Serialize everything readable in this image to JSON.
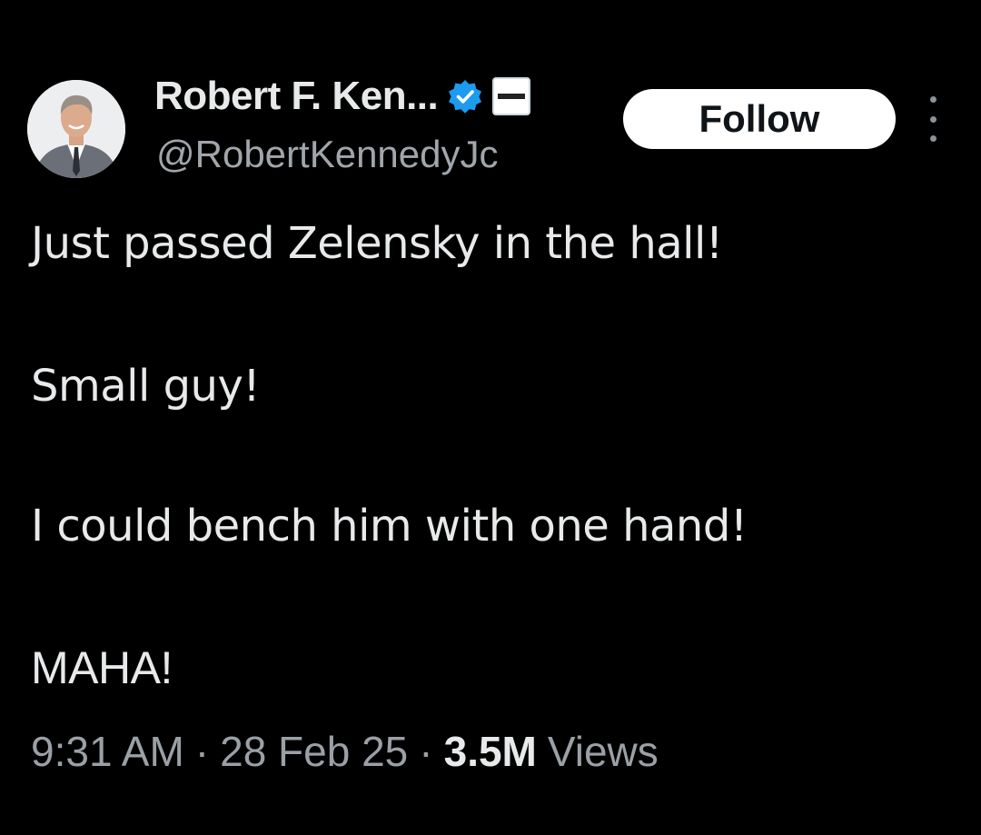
{
  "author": {
    "display_name": "Robert F. Ken...",
    "handle": "@RobertKennedyJc",
    "verified": true,
    "verified_color": "#1d9bf0"
  },
  "follow_button": {
    "label": "Follow"
  },
  "tweet": {
    "lines": [
      "Just passed Zelensky in the hall!",
      "Small guy!",
      "I could bench him with one hand!",
      "MAHA!"
    ]
  },
  "meta": {
    "time": "9:31 AM",
    "separator": "·",
    "date": "28 Feb 25",
    "views_count": "3.5M",
    "views_label": "Views"
  },
  "colors": {
    "background": "#000000",
    "text_primary": "#e7e9ea",
    "text_secondary": "#9aa0a6"
  }
}
